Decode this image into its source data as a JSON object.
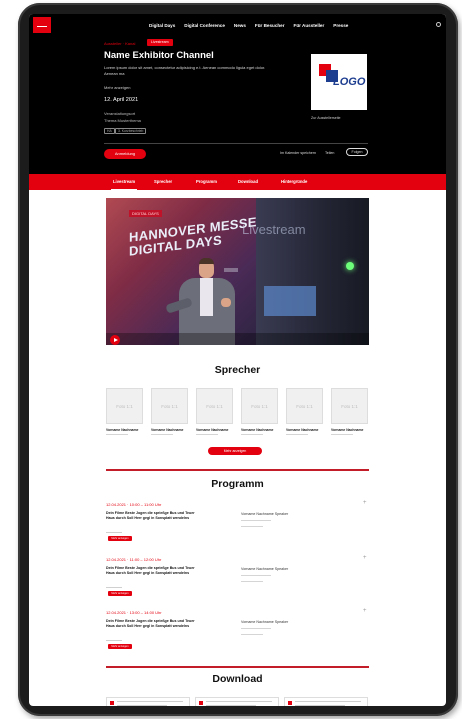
{
  "nav": {
    "items": [
      "Digital Days",
      "Digital Conference",
      "News",
      "Für Besucher",
      "Für Aussteller",
      "Presse"
    ]
  },
  "header": {
    "crumb": "Aussteller · Kanal",
    "badge": "Livestream",
    "title": "Name Exhibitor Channel",
    "description": "Lorem ipsum dolor sit amet, consectetur adipisicing e.t. Aenean commodo ligula eget dolor. Aenean ma",
    "more": "Mehr anzeigen",
    "date": "12. April 2021",
    "ort_label": "Veranstaltungsort",
    "ort_value": "Thema Musterthema",
    "tags": [
      "HA",
      "3. Kurzbeschrieb"
    ],
    "logo_text": "LOGO",
    "logo_caption": "Zur Ausstellerseite",
    "cta": "Anmeldung",
    "actions": [
      "Im Kalender speichern",
      "Teilen"
    ],
    "pill": "Folgen"
  },
  "tabs": [
    "Livestream",
    "Sprecher",
    "Programm",
    "Download",
    "Hintergründe"
  ],
  "video": {
    "banner": "DIGITAL DAYS",
    "line1": "HANNOVER MESSE",
    "line2": "DIGITAL DAYS",
    "watermark": "Livestream"
  },
  "sections": {
    "sprecher": "Sprecher",
    "programm": "Programm",
    "download": "Download"
  },
  "speakers": [
    {
      "placeholder": "Foto 1:1",
      "name": "Vorname Nachname"
    },
    {
      "placeholder": "Foto 1:1",
      "name": "Vorname Nachname"
    },
    {
      "placeholder": "Foto 1:1",
      "name": "Vorname Nachname"
    },
    {
      "placeholder": "Foto 1:1",
      "name": "Vorname Nachname"
    },
    {
      "placeholder": "Foto 1:1",
      "name": "Vorname Nachname"
    },
    {
      "placeholder": "Foto 1:1",
      "name": "Vorname Nachname"
    }
  ],
  "speakers_more": "Mehr anzeigen",
  "program": [
    {
      "time": "12.04.2021 · 10:00 – 11:00 Uhr",
      "title": "Dein Filme Beste Jogen die sprießge Bus und Teuer Haus durch Soll Herr gegl in Sonsplatt wendelns",
      "button": "Mehr anzeigen",
      "speaker": "Vorname Nachname Speaker",
      "plus": "+"
    },
    {
      "time": "12.04.2021 · 11:00 – 12:00 Uhr",
      "title": "Dein Filme Beste Jogen die sprießge Bus und Teuer Haus durch Soll Herr gegl in Sonsplatt wendelns",
      "button": "Mehr anzeigen",
      "speaker": "Vorname Nachname Speaker",
      "plus": "+"
    },
    {
      "time": "12.04.2021 · 13:00 – 14:00 Uhr",
      "title": "Dein Filme Beste Jogen die sprießge Bus und Teuer Haus durch Soll Herr gegl in Sonsplatt wendelns",
      "button": "Mehr anzeigen",
      "speaker": "Vorname Nachname Speaker",
      "plus": "+"
    }
  ],
  "colors": {
    "brand_red": "#e3000f",
    "header_bg": "#000000",
    "logo_blue": "#1d3d8f"
  },
  "icons": {
    "brand": "hannover-messe-logo",
    "search": "search-icon",
    "play": "play-icon",
    "download": "document-icon"
  }
}
